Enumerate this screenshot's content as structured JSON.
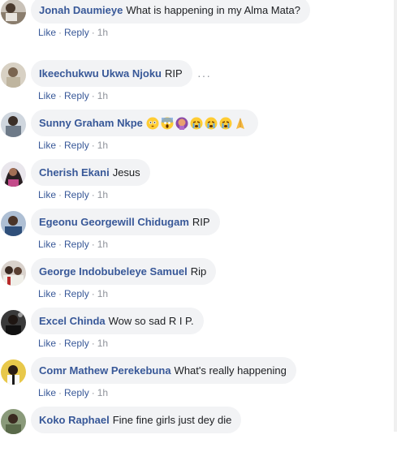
{
  "actions": {
    "like": "Like",
    "reply": "Reply",
    "separator": "·"
  },
  "comments": [
    {
      "author": "Jonah Daumieye",
      "text": "What is happening in my Alma Mata?",
      "time": "1h"
    },
    {
      "author": "Ikeechukwu Ukwa Njoku",
      "text": "RIP",
      "time": "1h",
      "more": "···"
    },
    {
      "author": "Sunny Graham Nkpe",
      "text": "",
      "time": "1h",
      "emojis": [
        "flushed-face",
        "screaming-face",
        "person-facepalming",
        "crying-face",
        "crying-face",
        "crying-face",
        "folded-hands"
      ]
    },
    {
      "author": "Cherish Ekani",
      "text": "Jesus",
      "time": "1h"
    },
    {
      "author": "Egeonu Georgewill Chidugam",
      "text": "RIP",
      "time": "1h"
    },
    {
      "author": "George Indobubeleye Samuel",
      "text": "Rip",
      "time": "1h"
    },
    {
      "author": "Excel Chinda",
      "text": "Wow so sad R I P.",
      "time": "1h"
    },
    {
      "author": "Comr Mathew Perekebuna",
      "text": "What's really happening",
      "time": "1h"
    },
    {
      "author": "Koko Raphael",
      "text": "Fine fine girls just dey die",
      "time": ""
    }
  ],
  "colors": {
    "author": "#385898",
    "bubble": "#f2f3f5",
    "meta": "#90949c"
  }
}
